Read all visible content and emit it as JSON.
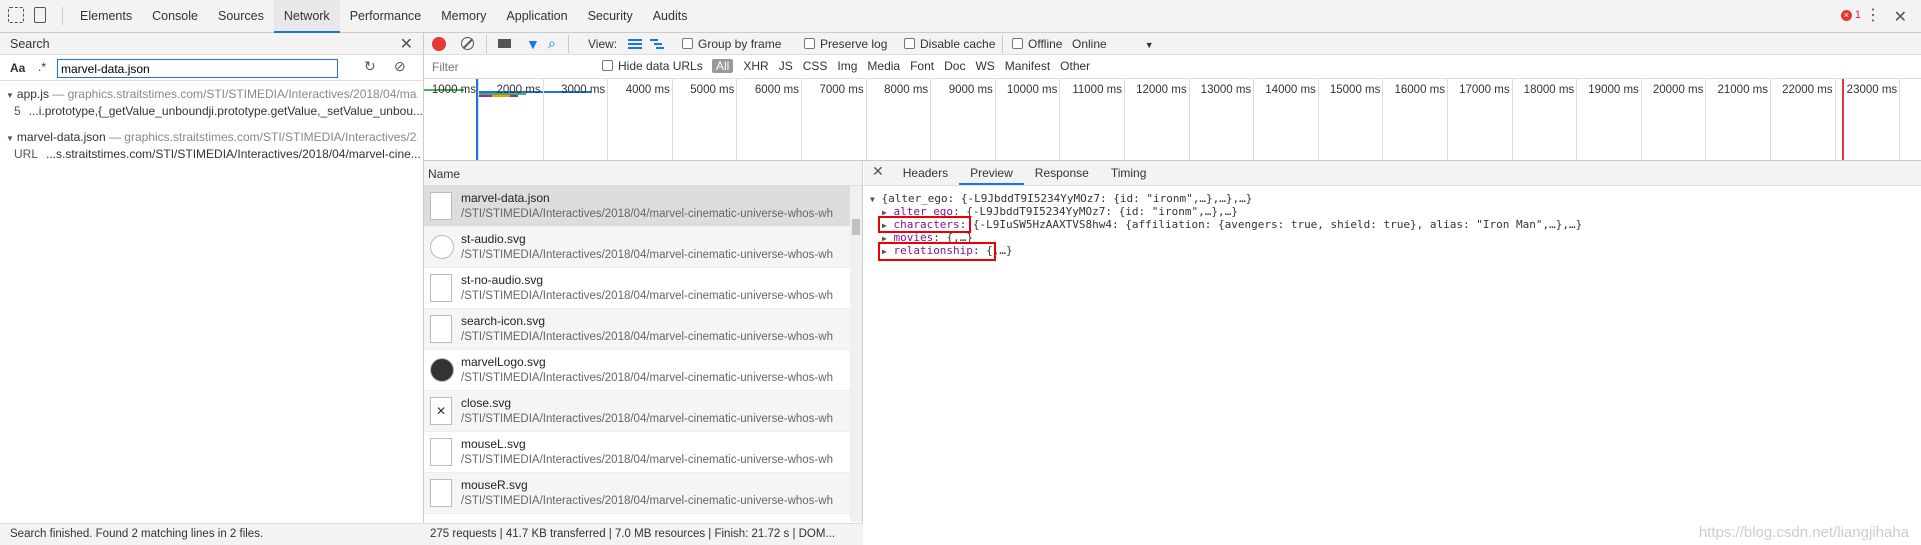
{
  "devtools": {
    "tabs": [
      "Elements",
      "Console",
      "Sources",
      "Network",
      "Performance",
      "Memory",
      "Application",
      "Security",
      "Audits"
    ],
    "active_tab": "Network",
    "error_count": "1"
  },
  "search_panel": {
    "title": "Search",
    "case_toggle": "Aa",
    "regex_toggle": ".*",
    "query": "marvel-data.json",
    "results": [
      {
        "file": "app.js",
        "url": " — graphics.straitstimes.com/STI/STIMEDIA/Interactives/2018/04/ma...",
        "line": "5",
        "match": "...i.prototype,{_getValue_unboundji.prototype.getValue,_setValue_unbou..."
      },
      {
        "file": "marvel-data.json",
        "url": " — graphics.straitstimes.com/STI/STIMEDIA/Interactives/2...",
        "line": "URL",
        "match": "...s.straitstimes.com/STI/STIMEDIA/Interactives/2018/04/marvel-cine..."
      }
    ],
    "status": "Search finished.  Found 2 matching lines in 2 files."
  },
  "network": {
    "toolbar": {
      "view_label": "View:",
      "group_by_frame": "Group by frame",
      "preserve_log": "Preserve log",
      "disable_cache": "Disable cache",
      "offline": "Offline",
      "throttling": "Online"
    },
    "filter": {
      "placeholder": "Filter",
      "hide_data_urls": "Hide data URLs",
      "types": [
        "All",
        "XHR",
        "JS",
        "CSS",
        "Img",
        "Media",
        "Font",
        "Doc",
        "WS",
        "Manifest",
        "Other"
      ]
    },
    "timeline_ticks": [
      "1000 ms",
      "2000 ms",
      "3000 ms",
      "4000 ms",
      "5000 ms",
      "6000 ms",
      "7000 ms",
      "8000 ms",
      "9000 ms",
      "10000 ms",
      "11000 ms",
      "12000 ms",
      "13000 ms",
      "14000 ms",
      "15000 ms",
      "16000 ms",
      "17000 ms",
      "18000 ms",
      "19000 ms",
      "20000 ms",
      "21000 ms",
      "22000 ms",
      "23000 ms"
    ],
    "list_header": "Name",
    "requests": [
      {
        "name": "marvel-data.json",
        "path": "/STI/STIMEDIA/Interactives/2018/04/marvel-cinematic-universe-whos-wh"
      },
      {
        "name": "st-audio.svg",
        "path": "/STI/STIMEDIA/Interactives/2018/04/marvel-cinematic-universe-whos-wh"
      },
      {
        "name": "st-no-audio.svg",
        "path": "/STI/STIMEDIA/Interactives/2018/04/marvel-cinematic-universe-whos-wh"
      },
      {
        "name": "search-icon.svg",
        "path": "/STI/STIMEDIA/Interactives/2018/04/marvel-cinematic-universe-whos-wh"
      },
      {
        "name": "marvelLogo.svg",
        "path": "/STI/STIMEDIA/Interactives/2018/04/marvel-cinematic-universe-whos-wh"
      },
      {
        "name": "close.svg",
        "path": "/STI/STIMEDIA/Interactives/2018/04/marvel-cinematic-universe-whos-wh"
      },
      {
        "name": "mouseL.svg",
        "path": "/STI/STIMEDIA/Interactives/2018/04/marvel-cinematic-universe-whos-wh"
      },
      {
        "name": "mouseR.svg",
        "path": "/STI/STIMEDIA/Interactives/2018/04/marvel-cinematic-universe-whos-wh"
      }
    ],
    "summary": "275 requests  |  41.7 KB transferred  |  7.0 MB resources  |  Finish: 21.72 s  |  DOM..."
  },
  "detail": {
    "tabs": [
      "Headers",
      "Preview",
      "Response",
      "Timing"
    ],
    "active_tab": "Preview",
    "preview": {
      "root": "{alter_ego: {-L9JbddT9I5234YyMOz7: {id: \"ironm\",…},…},…}",
      "lines": [
        {
          "key": "alter_ego",
          "value": " {-L9JbddT9I5234YyMOz7: {id: \"ironm\",…},…}"
        },
        {
          "key": "characters",
          "value": " {-L9IuSW5HzAAXTVS8hw4: {affiliation: {avengers: true, shield: true}, alias: \"Iron Man\",…},…}"
        },
        {
          "key": "movies",
          "value": " {,…}"
        },
        {
          "key": "relationship",
          "value": " {,…}"
        }
      ]
    }
  },
  "watermark": "https://blog.csdn.net/liangjihaha"
}
